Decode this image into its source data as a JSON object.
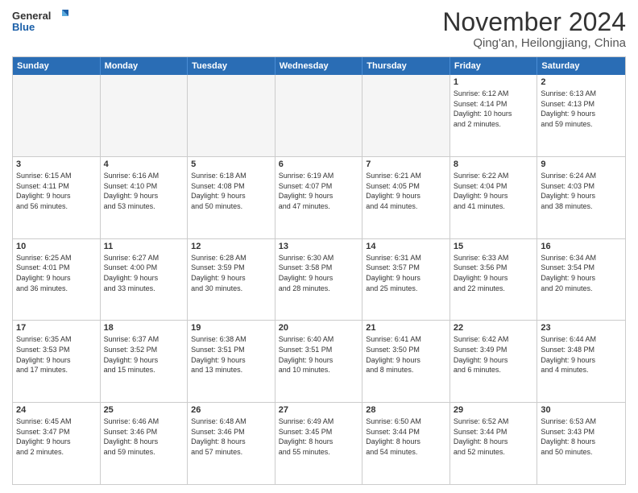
{
  "logo": {
    "line1": "General",
    "line2": "Blue"
  },
  "title": "November 2024",
  "location": "Qing'an, Heilongjiang, China",
  "weekdays": [
    "Sunday",
    "Monday",
    "Tuesday",
    "Wednesday",
    "Thursday",
    "Friday",
    "Saturday"
  ],
  "weeks": [
    [
      {
        "day": "",
        "empty": true
      },
      {
        "day": "",
        "empty": true
      },
      {
        "day": "",
        "empty": true
      },
      {
        "day": "",
        "empty": true
      },
      {
        "day": "",
        "empty": true
      },
      {
        "day": "1",
        "sunrise": "Sunrise: 6:12 AM",
        "sunset": "Sunset: 4:14 PM",
        "daylight": "Daylight: 10 hours",
        "daylight2": "and 2 minutes."
      },
      {
        "day": "2",
        "sunrise": "Sunrise: 6:13 AM",
        "sunset": "Sunset: 4:13 PM",
        "daylight": "Daylight: 9 hours",
        "daylight2": "and 59 minutes."
      }
    ],
    [
      {
        "day": "3",
        "sunrise": "Sunrise: 6:15 AM",
        "sunset": "Sunset: 4:11 PM",
        "daylight": "Daylight: 9 hours",
        "daylight2": "and 56 minutes."
      },
      {
        "day": "4",
        "sunrise": "Sunrise: 6:16 AM",
        "sunset": "Sunset: 4:10 PM",
        "daylight": "Daylight: 9 hours",
        "daylight2": "and 53 minutes."
      },
      {
        "day": "5",
        "sunrise": "Sunrise: 6:18 AM",
        "sunset": "Sunset: 4:08 PM",
        "daylight": "Daylight: 9 hours",
        "daylight2": "and 50 minutes."
      },
      {
        "day": "6",
        "sunrise": "Sunrise: 6:19 AM",
        "sunset": "Sunset: 4:07 PM",
        "daylight": "Daylight: 9 hours",
        "daylight2": "and 47 minutes."
      },
      {
        "day": "7",
        "sunrise": "Sunrise: 6:21 AM",
        "sunset": "Sunset: 4:05 PM",
        "daylight": "Daylight: 9 hours",
        "daylight2": "and 44 minutes."
      },
      {
        "day": "8",
        "sunrise": "Sunrise: 6:22 AM",
        "sunset": "Sunset: 4:04 PM",
        "daylight": "Daylight: 9 hours",
        "daylight2": "and 41 minutes."
      },
      {
        "day": "9",
        "sunrise": "Sunrise: 6:24 AM",
        "sunset": "Sunset: 4:03 PM",
        "daylight": "Daylight: 9 hours",
        "daylight2": "and 38 minutes."
      }
    ],
    [
      {
        "day": "10",
        "sunrise": "Sunrise: 6:25 AM",
        "sunset": "Sunset: 4:01 PM",
        "daylight": "Daylight: 9 hours",
        "daylight2": "and 36 minutes."
      },
      {
        "day": "11",
        "sunrise": "Sunrise: 6:27 AM",
        "sunset": "Sunset: 4:00 PM",
        "daylight": "Daylight: 9 hours",
        "daylight2": "and 33 minutes."
      },
      {
        "day": "12",
        "sunrise": "Sunrise: 6:28 AM",
        "sunset": "Sunset: 3:59 PM",
        "daylight": "Daylight: 9 hours",
        "daylight2": "and 30 minutes."
      },
      {
        "day": "13",
        "sunrise": "Sunrise: 6:30 AM",
        "sunset": "Sunset: 3:58 PM",
        "daylight": "Daylight: 9 hours",
        "daylight2": "and 28 minutes."
      },
      {
        "day": "14",
        "sunrise": "Sunrise: 6:31 AM",
        "sunset": "Sunset: 3:57 PM",
        "daylight": "Daylight: 9 hours",
        "daylight2": "and 25 minutes."
      },
      {
        "day": "15",
        "sunrise": "Sunrise: 6:33 AM",
        "sunset": "Sunset: 3:56 PM",
        "daylight": "Daylight: 9 hours",
        "daylight2": "and 22 minutes."
      },
      {
        "day": "16",
        "sunrise": "Sunrise: 6:34 AM",
        "sunset": "Sunset: 3:54 PM",
        "daylight": "Daylight: 9 hours",
        "daylight2": "and 20 minutes."
      }
    ],
    [
      {
        "day": "17",
        "sunrise": "Sunrise: 6:35 AM",
        "sunset": "Sunset: 3:53 PM",
        "daylight": "Daylight: 9 hours",
        "daylight2": "and 17 minutes."
      },
      {
        "day": "18",
        "sunrise": "Sunrise: 6:37 AM",
        "sunset": "Sunset: 3:52 PM",
        "daylight": "Daylight: 9 hours",
        "daylight2": "and 15 minutes."
      },
      {
        "day": "19",
        "sunrise": "Sunrise: 6:38 AM",
        "sunset": "Sunset: 3:51 PM",
        "daylight": "Daylight: 9 hours",
        "daylight2": "and 13 minutes."
      },
      {
        "day": "20",
        "sunrise": "Sunrise: 6:40 AM",
        "sunset": "Sunset: 3:51 PM",
        "daylight": "Daylight: 9 hours",
        "daylight2": "and 10 minutes."
      },
      {
        "day": "21",
        "sunrise": "Sunrise: 6:41 AM",
        "sunset": "Sunset: 3:50 PM",
        "daylight": "Daylight: 9 hours",
        "daylight2": "and 8 minutes."
      },
      {
        "day": "22",
        "sunrise": "Sunrise: 6:42 AM",
        "sunset": "Sunset: 3:49 PM",
        "daylight": "Daylight: 9 hours",
        "daylight2": "and 6 minutes."
      },
      {
        "day": "23",
        "sunrise": "Sunrise: 6:44 AM",
        "sunset": "Sunset: 3:48 PM",
        "daylight": "Daylight: 9 hours",
        "daylight2": "and 4 minutes."
      }
    ],
    [
      {
        "day": "24",
        "sunrise": "Sunrise: 6:45 AM",
        "sunset": "Sunset: 3:47 PM",
        "daylight": "Daylight: 9 hours",
        "daylight2": "and 2 minutes."
      },
      {
        "day": "25",
        "sunrise": "Sunrise: 6:46 AM",
        "sunset": "Sunset: 3:46 PM",
        "daylight": "Daylight: 8 hours",
        "daylight2": "and 59 minutes."
      },
      {
        "day": "26",
        "sunrise": "Sunrise: 6:48 AM",
        "sunset": "Sunset: 3:46 PM",
        "daylight": "Daylight: 8 hours",
        "daylight2": "and 57 minutes."
      },
      {
        "day": "27",
        "sunrise": "Sunrise: 6:49 AM",
        "sunset": "Sunset: 3:45 PM",
        "daylight": "Daylight: 8 hours",
        "daylight2": "and 55 minutes."
      },
      {
        "day": "28",
        "sunrise": "Sunrise: 6:50 AM",
        "sunset": "Sunset: 3:44 PM",
        "daylight": "Daylight: 8 hours",
        "daylight2": "and 54 minutes."
      },
      {
        "day": "29",
        "sunrise": "Sunrise: 6:52 AM",
        "sunset": "Sunset: 3:44 PM",
        "daylight": "Daylight: 8 hours",
        "daylight2": "and 52 minutes."
      },
      {
        "day": "30",
        "sunrise": "Sunrise: 6:53 AM",
        "sunset": "Sunset: 3:43 PM",
        "daylight": "Daylight: 8 hours",
        "daylight2": "and 50 minutes."
      }
    ]
  ]
}
